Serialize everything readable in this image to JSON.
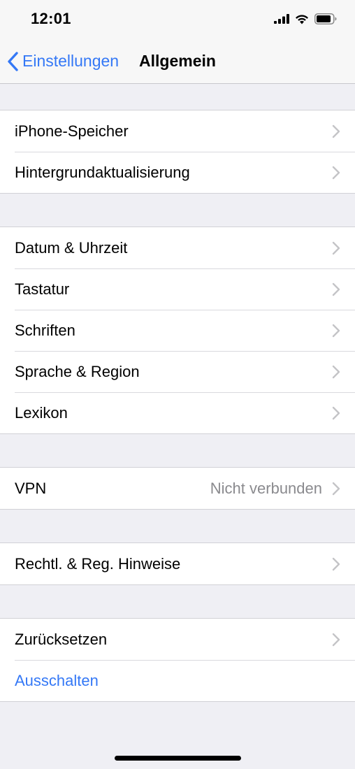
{
  "status_bar": {
    "time": "12:01",
    "icons": [
      "cellular-signal-icon",
      "wifi-icon",
      "battery-icon"
    ]
  },
  "nav": {
    "back_label": "Einstellungen",
    "title": "Allgemein"
  },
  "groups": [
    {
      "rows": [
        {
          "label": "iPhone-Speicher"
        },
        {
          "label": "Hintergrundaktualisierung"
        }
      ]
    },
    {
      "rows": [
        {
          "label": "Datum & Uhrzeit"
        },
        {
          "label": "Tastatur"
        },
        {
          "label": "Schriften"
        },
        {
          "label": "Sprache & Region"
        },
        {
          "label": "Lexikon"
        }
      ]
    },
    {
      "rows": [
        {
          "label": "VPN",
          "detail": "Nicht verbunden"
        }
      ]
    },
    {
      "rows": [
        {
          "label": "Rechtl. & Reg. Hinweise"
        }
      ]
    },
    {
      "rows": [
        {
          "label": "Zurücksetzen"
        },
        {
          "label": "Ausschalten"
        }
      ]
    }
  ],
  "colors": {
    "accent": "#3478f6",
    "background": "#efeff4",
    "secondary_text": "#8a8a8e"
  }
}
